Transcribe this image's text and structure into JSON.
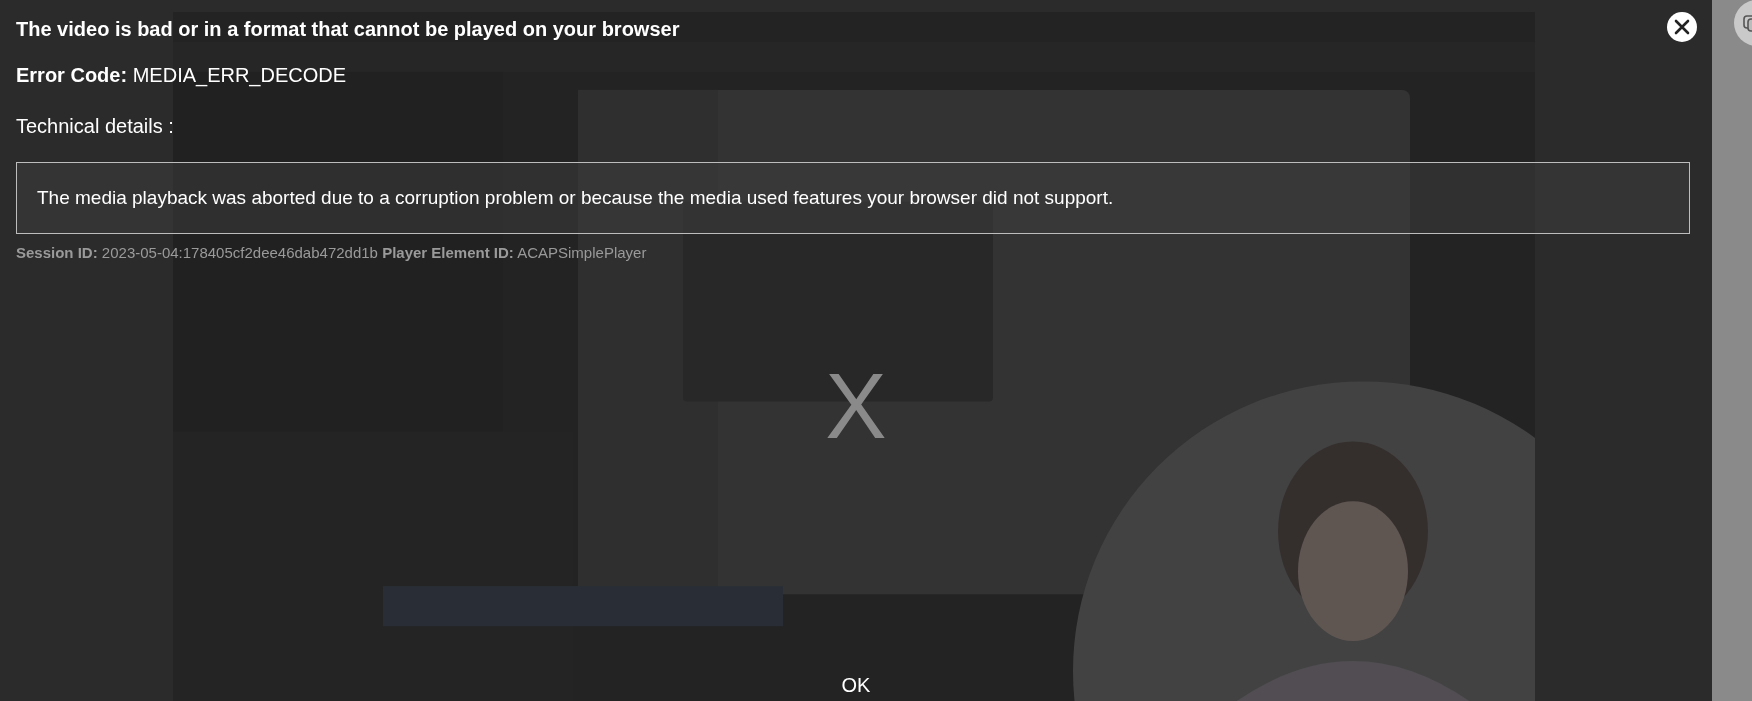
{
  "error_dialog": {
    "title": "The video is bad or in a format that cannot be played on your browser",
    "error_code_label": "Error Code:",
    "error_code": "MEDIA_ERR_DECODE",
    "technical_details_label": "Technical details :",
    "message": "The media playback was aborted due to a corruption problem or because the media used features your browser did not support.",
    "session_id_label": "Session ID:",
    "session_id": "2023-05-04:178405cf2dee46dab472dd1b",
    "player_element_id_label": "Player Element ID:",
    "player_element_id": "ACAPSimplePlayer",
    "error_mark": "X",
    "ok_button": "OK"
  }
}
